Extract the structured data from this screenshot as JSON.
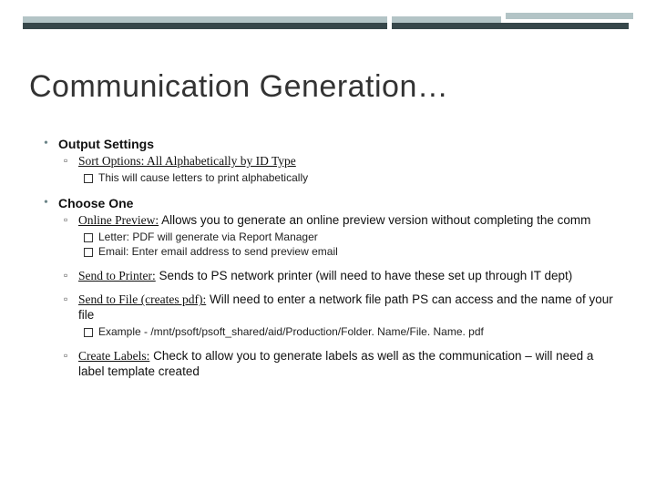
{
  "title": "Communication Generation…",
  "bullets": [
    {
      "head": "Output Settings",
      "items": [
        {
          "label": "Sort Options: All Alphabetically by ID Type",
          "text": "",
          "sub": [
            "This will cause letters to print alphabetically"
          ]
        }
      ]
    },
    {
      "head": "Choose One",
      "items": [
        {
          "label": "Online Preview:",
          "text": " Allows you to generate an online preview version without completing the comm",
          "sub": [
            "Letter: PDF will generate via Report Manager",
            "Email: Enter email address to send preview email"
          ]
        },
        {
          "label": "Send to Printer:",
          "text": " Sends to PS network printer (will need to have these set up through IT dept)",
          "sub": []
        },
        {
          "label": "Send to File (creates pdf):",
          "text": " Will need to enter a network file path PS can access and the name of your file",
          "sub": [
            "Example - /mnt/psoft/psoft_shared/aid/Production/Folder. Name/File. Name. pdf"
          ]
        },
        {
          "label": "Create Labels:",
          "text": " Check to allow you to generate labels as well as the communication – will need a label template created",
          "sub": []
        }
      ]
    }
  ]
}
